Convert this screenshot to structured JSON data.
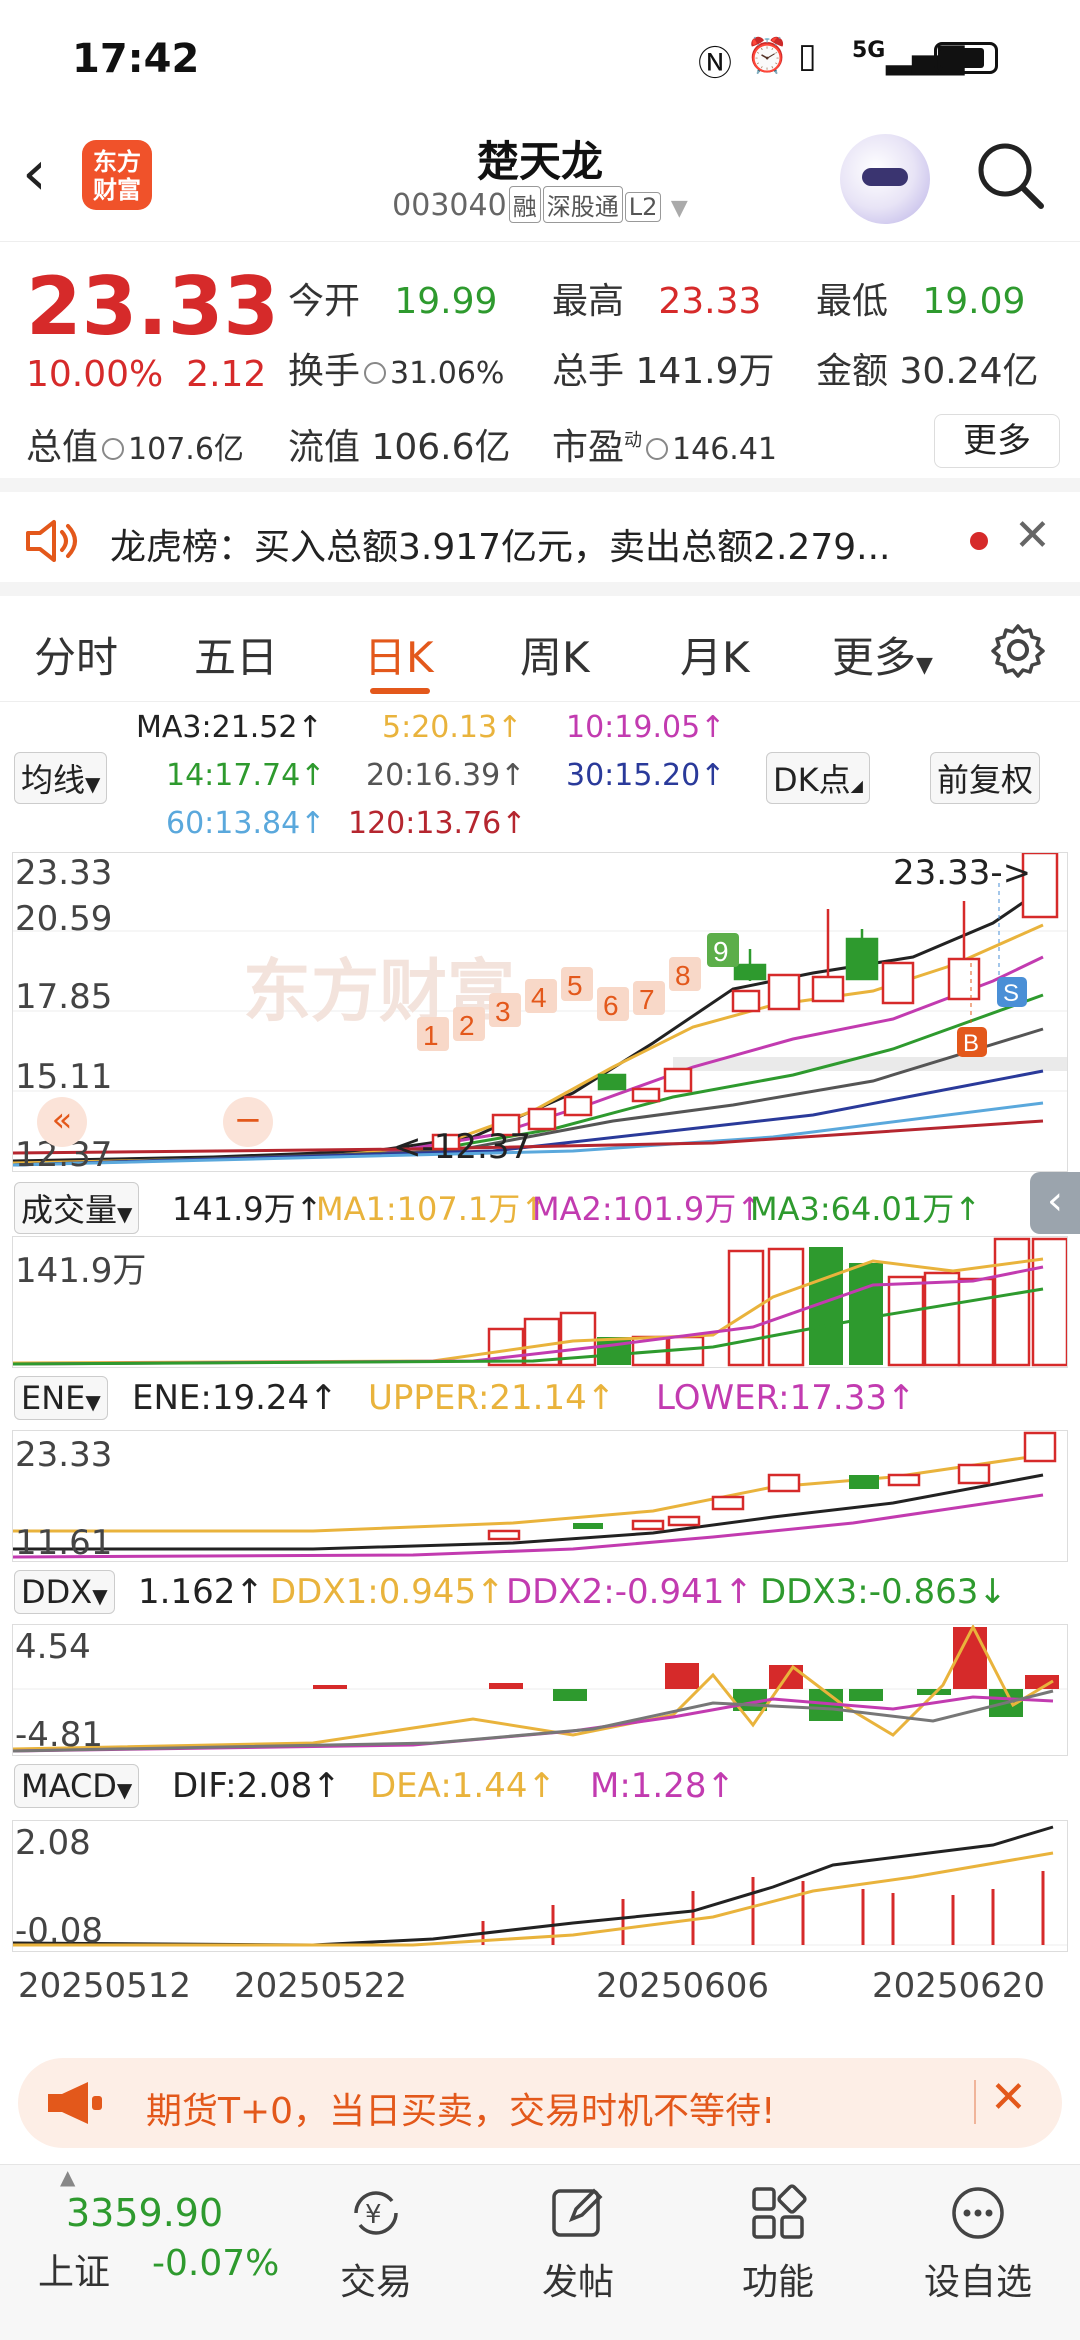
{
  "status": {
    "time": "17:42",
    "network": "5G"
  },
  "header": {
    "logo_line1": "东方",
    "logo_line2": "财富",
    "name": "楚天龙",
    "code": "003040",
    "tags": [
      "融",
      "深股通",
      "L2"
    ]
  },
  "quote": {
    "price": "23.33",
    "change_pct": "10.00%",
    "change_amt": "2.12",
    "open_label": "今开",
    "open": "19.99",
    "high_label": "最高",
    "high": "23.33",
    "low_label": "最低",
    "low": "19.09",
    "turnover_label": "换手",
    "turnover": "31.06%",
    "volume_label": "总手",
    "volume": "141.9万",
    "amount_label": "金额",
    "amount": "30.24亿",
    "mktcap_label": "总值",
    "mktcap": "107.6亿",
    "float_label": "流值",
    "float": "106.6亿",
    "pe_label": "市盈",
    "pe_sup": "动",
    "pe": "146.41",
    "more": "更多"
  },
  "dragon": {
    "text": "龙虎榜：买入总额3.917亿元，卖出总额2.279..."
  },
  "tabs": [
    "分时",
    "五日",
    "日K",
    "周K",
    "月K",
    "更多"
  ],
  "ma": {
    "select": "均线",
    "ma3": "MA3:21.52↑",
    "ma5": "5:20.13↑",
    "ma10": "10:19.05↑",
    "ma14": "14:17.74↑",
    "ma20": "20:16.39↑",
    "ma30": "30:15.20↑",
    "ma60": "60:13.84↑",
    "ma120": "120:13.76↑",
    "dk": "DK点",
    "fq": "前复权"
  },
  "kline": {
    "y_labels": [
      "23.33",
      "20.59",
      "17.85",
      "15.11",
      "12.37"
    ],
    "high_note": "23.33->",
    "low_note": "<-12.37",
    "watermark": "东方财富",
    "markers": [
      "1",
      "2",
      "3",
      "4",
      "5",
      "6",
      "7",
      "8",
      "9"
    ],
    "sell": "S",
    "buy": "B"
  },
  "volume": {
    "select": "成交量",
    "value": "141.9万↑",
    "ma1": "MA1:107.1万↑",
    "ma2": "MA2:101.9万↑",
    "ma3": "MA3:64.01万↑",
    "top": "141.9万"
  },
  "ene": {
    "select": "ENE",
    "ene": "ENE:19.24↑",
    "upper": "UPPER:21.14↑",
    "lower": "LOWER:17.33↑",
    "top": "23.33",
    "bottom": "11.61"
  },
  "ddx": {
    "select": "DDX",
    "value": "1.162↑",
    "ddx1": "DDX1:0.945↑",
    "ddx2": "DDX2:-0.941↑",
    "ddx3": "DDX3:-0.863↓",
    "top": "4.54",
    "bottom": "-4.81"
  },
  "macd": {
    "select": "MACD",
    "dif": "DIF:2.08↑",
    "dea": "DEA:1.44↑",
    "m": "M:1.28↑",
    "top": "2.08",
    "bottom": "-0.08"
  },
  "dates": [
    "20250512",
    "20250522",
    "20250606",
    "20250620"
  ],
  "promo": {
    "text": "期货T+0，当日买卖，交易时机不等待!"
  },
  "bottom": {
    "index_value": "3359.90",
    "index_name": "上证",
    "index_change": "-0.07%",
    "items": [
      "交易",
      "发帖",
      "功能",
      "设自选"
    ]
  },
  "colors": {
    "up": "#d62a2a",
    "down": "#2e9a2e",
    "accent": "#e3581b"
  }
}
